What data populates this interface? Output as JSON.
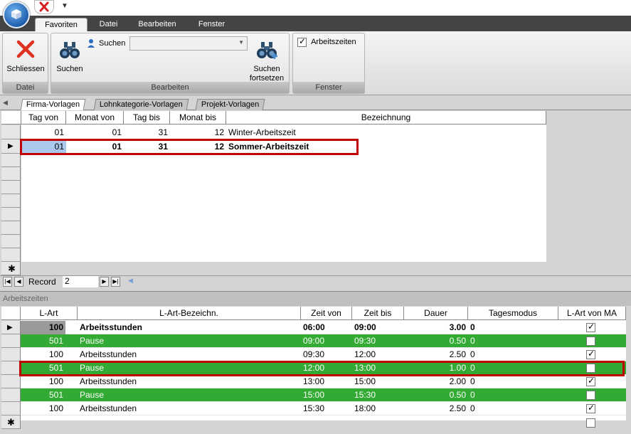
{
  "ribbon": {
    "tabs": [
      "Favoriten",
      "Datei",
      "Bearbeiten",
      "Fenster"
    ],
    "active_tab": "Favoriten",
    "groups": {
      "datei": {
        "label": "Datei",
        "close_label": "Schliessen"
      },
      "bearbeiten": {
        "label": "Bearbeiten",
        "search_label": "Suchen",
        "search_field_label": "Suchen",
        "search_field_value": "",
        "continue_label_1": "Suchen",
        "continue_label_2": "fortsetzen"
      },
      "fenster": {
        "label": "Fenster",
        "arbeitszeiten_label": "Arbeitszeiten",
        "arbeitszeiten_checked": true
      }
    }
  },
  "subtabs": [
    "Firma-Vorlagen",
    "Lohnkategorie-Vorlagen",
    "Projekt-Vorlagen"
  ],
  "top_grid": {
    "columns": [
      "Tag von",
      "Monat von",
      "Tag bis",
      "Monat bis",
      "Bezeichnung"
    ],
    "rows": [
      [
        "01",
        "01",
        "31",
        "12",
        "Winter-Arbeitszeit"
      ],
      [
        "01",
        "01",
        "31",
        "12",
        "Sommer-Arbeitszeit"
      ]
    ],
    "current_row": 2
  },
  "navigator": {
    "record_label": "Record",
    "record_value": "2"
  },
  "bottom_section": {
    "title": "Arbeitszeiten"
  },
  "bottom_grid": {
    "columns": [
      "L-Art",
      "L-Art-Bezeichn.",
      "Zeit von",
      "Zeit bis",
      "Dauer",
      "Tagesmodus",
      "L-Art von MA"
    ],
    "rows": [
      {
        "lart": "100",
        "name": "Arbeitsstunden",
        "von": "06:00",
        "bis": "09:00",
        "dauer": "3.00",
        "modus": "0",
        "ma": true
      },
      {
        "lart": "501",
        "name": "Pause",
        "von": "09:00",
        "bis": "09:30",
        "dauer": "0.50",
        "modus": "0",
        "ma": false
      },
      {
        "lart": "100",
        "name": "Arbeitsstunden",
        "von": "09:30",
        "bis": "12:00",
        "dauer": "2.50",
        "modus": "0",
        "ma": true
      },
      {
        "lart": "501",
        "name": "Pause",
        "von": "12:00",
        "bis": "13:00",
        "dauer": "1.00",
        "modus": "0",
        "ma": false
      },
      {
        "lart": "100",
        "name": "Arbeitsstunden",
        "von": "13:00",
        "bis": "15:00",
        "dauer": "2.00",
        "modus": "0",
        "ma": true
      },
      {
        "lart": "501",
        "name": "Pause",
        "von": "15:00",
        "bis": "15:30",
        "dauer": "0.50",
        "modus": "0",
        "ma": false
      },
      {
        "lart": "100",
        "name": "Arbeitsstunden",
        "von": "15:30",
        "bis": "18:00",
        "dauer": "2.50",
        "modus": "0",
        "ma": true
      }
    ]
  },
  "colors": {
    "pause_row": "#33aa33",
    "highlight": "#c00000",
    "selection": "#aac8ee"
  }
}
